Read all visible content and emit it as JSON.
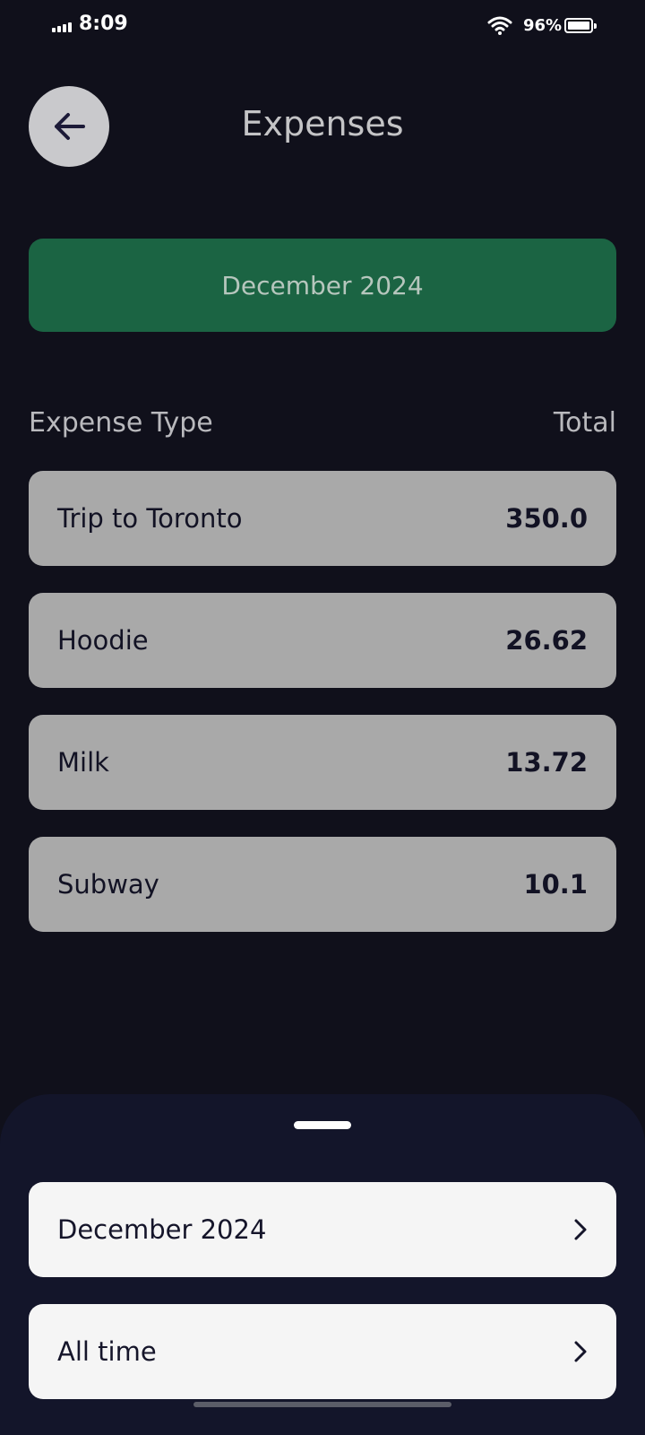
{
  "status_bar": {
    "time": "8:09",
    "battery_percent": "96%",
    "battery_level": 0.96
  },
  "header": {
    "title": "Expenses",
    "back_icon": "arrow-left-icon"
  },
  "month_banner": {
    "label": "December 2024",
    "color": "#1b6443"
  },
  "columns": {
    "type_label": "Expense Type",
    "total_label": "Total"
  },
  "expenses": [
    {
      "name": "Trip to Toronto",
      "total": "350.0"
    },
    {
      "name": "Hoodie",
      "total": "26.62"
    },
    {
      "name": "Milk",
      "total": "13.72"
    },
    {
      "name": "Subway",
      "total": "10.1"
    }
  ],
  "sheet": {
    "options": [
      {
        "label": "December 2024",
        "icon": "chevron-right-icon"
      },
      {
        "label": "All time",
        "icon": "chevron-right-icon"
      }
    ]
  }
}
